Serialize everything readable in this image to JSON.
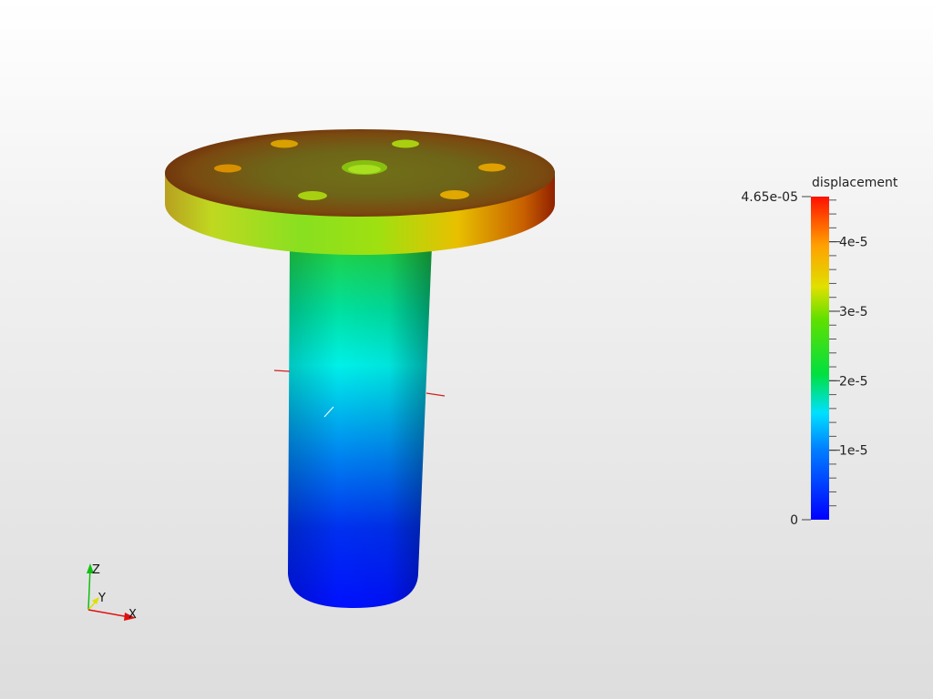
{
  "scene": {
    "colors": {
      "background_top": "#ffffff",
      "background_bottom": "#dddddd",
      "scale_low": "#0000ff",
      "scale_high": "#ff0000"
    }
  },
  "colorbar": {
    "title": "displacement",
    "max_label": "4.65e-05",
    "min_label": "0",
    "ticks": [
      {
        "label": "4e-5",
        "value": 4e-05
      },
      {
        "label": "3e-5",
        "value": 3e-05
      },
      {
        "label": "2e-5",
        "value": 2e-05
      },
      {
        "label": "1e-5",
        "value": 1e-05
      }
    ],
    "range": [
      0,
      4.65e-05
    ]
  },
  "axes_widget": {
    "x_label": "X",
    "y_label": "Y",
    "z_label": "Z",
    "x_color": "#e01010",
    "y_color": "#e0e000",
    "z_color": "#10c010"
  }
}
